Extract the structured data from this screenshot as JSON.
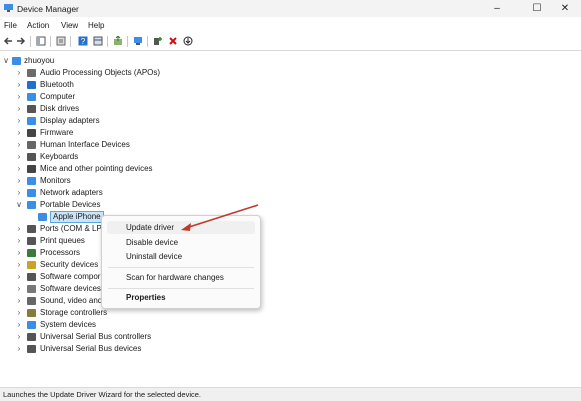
{
  "window": {
    "title": "Device Manager",
    "minimize": "–",
    "maximize": "☐",
    "close": "✕"
  },
  "menu": [
    "File",
    "Action",
    "View",
    "Help"
  ],
  "toolbar": {
    "icons": [
      "back-arrow-icon",
      "forward-arrow-icon",
      "show-hide-console-tree-icon",
      "properties-icon",
      "help-icon",
      "view-icon",
      "update-driver-icon",
      "scan-hardware-icon",
      "add-legacy-hardware-icon",
      "uninstall-icon",
      "disable-icon"
    ]
  },
  "tree": {
    "root": "zhuoyou",
    "categories": [
      {
        "label": "Audio Processing Objects (APOs)",
        "icon": "audio-icon",
        "color": "#6b6b6b"
      },
      {
        "label": "Bluetooth",
        "icon": "bluetooth-icon",
        "color": "#1f6fd1"
      },
      {
        "label": "Computer",
        "icon": "computer-icon",
        "color": "#3a8ee6"
      },
      {
        "label": "Disk drives",
        "icon": "disk-drive-icon",
        "color": "#555555"
      },
      {
        "label": "Display adapters",
        "icon": "display-adapter-icon",
        "color": "#3a8ee6"
      },
      {
        "label": "Firmware",
        "icon": "firmware-icon",
        "color": "#444444"
      },
      {
        "label": "Human Interface Devices",
        "icon": "hid-icon",
        "color": "#666666"
      },
      {
        "label": "Keyboards",
        "icon": "keyboard-icon",
        "color": "#555555"
      },
      {
        "label": "Mice and other pointing devices",
        "icon": "mouse-icon",
        "color": "#444444"
      },
      {
        "label": "Monitors",
        "icon": "monitor-icon",
        "color": "#3a8ee6"
      },
      {
        "label": "Network adapters",
        "icon": "network-adapter-icon",
        "color": "#3a8ee6"
      },
      {
        "label": "Portable Devices",
        "icon": "portable-device-icon",
        "color": "#3a8ee6",
        "expanded": true
      },
      {
        "label": "Ports (COM & LP",
        "icon": "port-icon",
        "color": "#555555"
      },
      {
        "label": "Print queues",
        "icon": "printer-icon",
        "color": "#555555"
      },
      {
        "label": "Processors",
        "icon": "processor-icon",
        "color": "#3c7a3c"
      },
      {
        "label": "Security devices",
        "icon": "security-device-icon",
        "color": "#c9a227"
      },
      {
        "label": "Software compor",
        "icon": "software-component-icon",
        "color": "#555555"
      },
      {
        "label": "Software devices",
        "icon": "software-device-icon",
        "color": "#777777"
      },
      {
        "label": "Sound, video and",
        "icon": "sound-icon",
        "color": "#666666"
      },
      {
        "label": "Storage controllers",
        "icon": "storage-controller-icon",
        "color": "#8a7a3a"
      },
      {
        "label": "System devices",
        "icon": "system-device-icon",
        "color": "#3a8ee6"
      },
      {
        "label": "Universal Serial Bus controllers",
        "icon": "usb-icon",
        "color": "#555555"
      },
      {
        "label": "Universal Serial Bus devices",
        "icon": "usb-icon",
        "color": "#555555"
      }
    ],
    "child_of_portable": {
      "label": "Apple iPhone",
      "icon": "phone-icon",
      "color": "#3a8ee6"
    }
  },
  "context_menu": {
    "update_driver": "Update driver",
    "disable_device": "Disable device",
    "uninstall_device": "Uninstall device",
    "scan": "Scan for hardware changes",
    "properties": "Properties"
  },
  "annotation": {
    "arrow_color": "#c0392b"
  },
  "status": "Launches the Update Driver Wizard for the selected device."
}
